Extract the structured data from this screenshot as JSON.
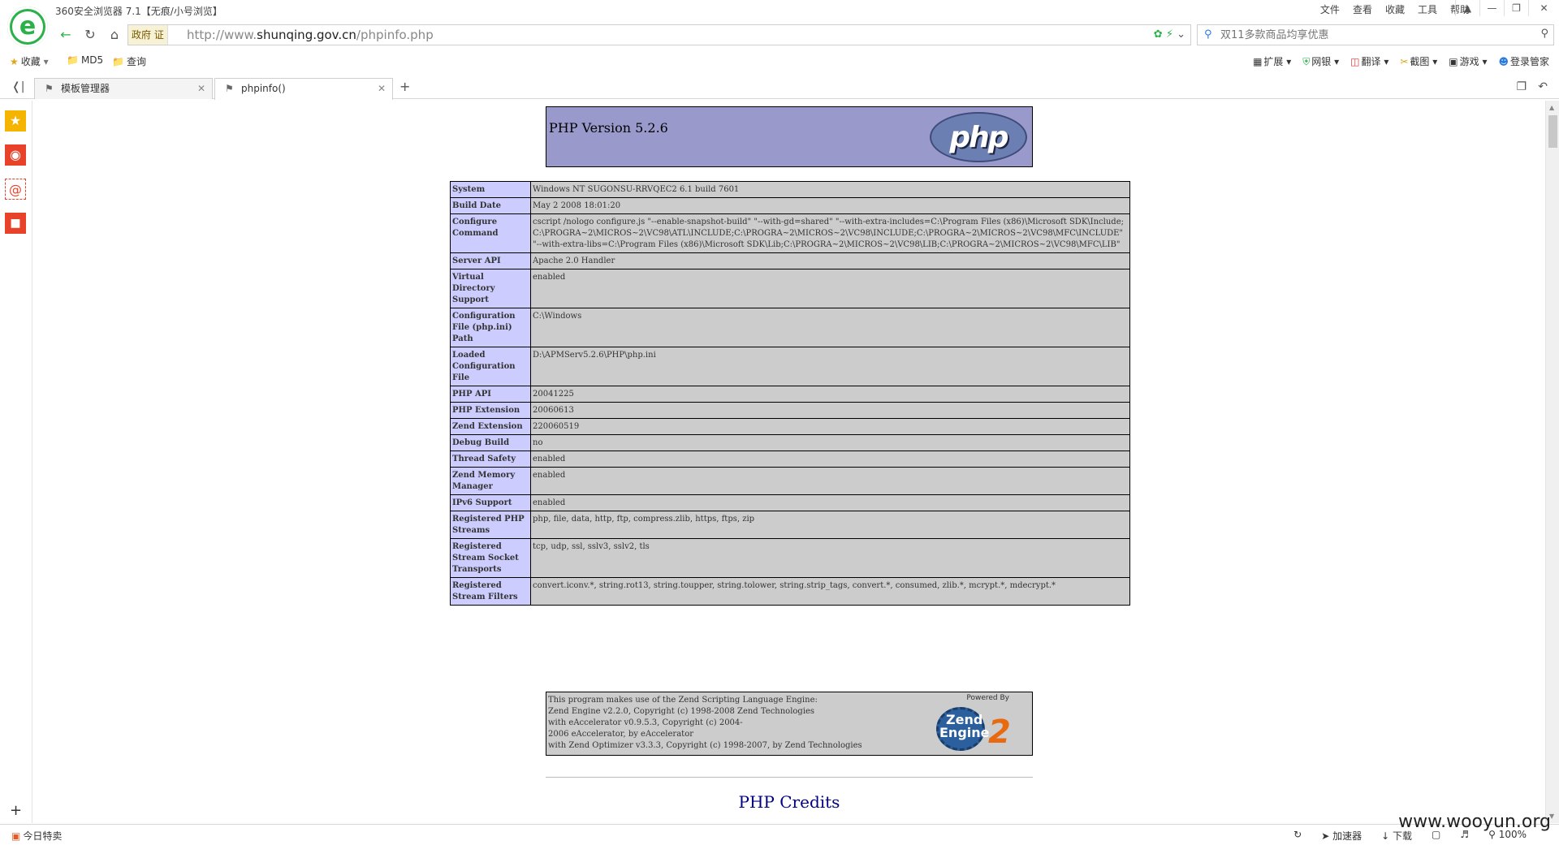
{
  "browser": {
    "title": "360安全浏览器 7.1【无痕/小号浏览】",
    "logo_letter": "e",
    "menu": [
      "文件",
      "查看",
      "收藏",
      "工具",
      "帮助"
    ],
    "window_controls": [
      "shirt-icon",
      "minimize-icon",
      "restore-icon",
      "close-icon"
    ]
  },
  "address": {
    "gov_badge": "政府 证",
    "url_prefix": "http://www.",
    "url_domain": "shunqing.gov.cn",
    "url_path": "/phpinfo.php",
    "search_placeholder": "双11多款商品均享优惠"
  },
  "bookmarks": {
    "items": [
      "收藏",
      "MD5",
      "查询"
    ],
    "tools": [
      "扩展",
      "网银",
      "翻译",
      "截图",
      "游戏",
      "登录管家"
    ]
  },
  "tabs": [
    {
      "label": "模板管理器",
      "active": false
    },
    {
      "label": "phpinfo()",
      "active": true
    }
  ],
  "php": {
    "version_title": "PHP Version 5.2.6",
    "logo_text": "php",
    "rows": [
      {
        "key": "System",
        "value": "Windows NT SUGONSU-RRVQEC2 6.1 build 7601"
      },
      {
        "key": "Build Date",
        "value": "May 2 2008 18:01:20"
      },
      {
        "key": "Configure Command",
        "value": "cscript /nologo configure.js \"--enable-snapshot-build\" \"--with-gd=shared\" \"--with-extra-includes=C:\\Program Files (x86)\\Microsoft SDK\\Include;C:\\PROGRA~2\\MICROS~2\\VC98\\ATL\\INCLUDE;C:\\PROGRA~2\\MICROS~2\\VC98\\INCLUDE;C:\\PROGRA~2\\MICROS~2\\VC98\\MFC\\INCLUDE\" \"--with-extra-libs=C:\\Program Files (x86)\\Microsoft SDK\\Lib;C:\\PROGRA~2\\MICROS~2\\VC98\\LIB;C:\\PROGRA~2\\MICROS~2\\VC98\\MFC\\LIB\""
      },
      {
        "key": "Server API",
        "value": "Apache 2.0 Handler"
      },
      {
        "key": "Virtual Directory Support",
        "value": "enabled"
      },
      {
        "key": "Configuration File (php.ini) Path",
        "value": "C:\\Windows"
      },
      {
        "key": "Loaded Configuration File",
        "value": "D:\\APMServ5.2.6\\PHP\\php.ini"
      },
      {
        "key": "PHP API",
        "value": "20041225"
      },
      {
        "key": "PHP Extension",
        "value": "20060613"
      },
      {
        "key": "Zend Extension",
        "value": "220060519"
      },
      {
        "key": "Debug Build",
        "value": "no"
      },
      {
        "key": "Thread Safety",
        "value": "enabled"
      },
      {
        "key": "Zend Memory Manager",
        "value": "enabled"
      },
      {
        "key": "IPv6 Support",
        "value": "enabled"
      },
      {
        "key": "Registered PHP Streams",
        "value": "php, file, data, http, ftp, compress.zlib, https, ftps, zip"
      },
      {
        "key": "Registered Stream Socket Transports",
        "value": "tcp, udp, ssl, sslv3, sslv2, tls"
      },
      {
        "key": "Registered Stream Filters",
        "value": "convert.iconv.*, string.rot13, string.toupper, string.tolower, string.strip_tags, convert.*, consumed, zlib.*, mcrypt.*, mdecrypt.*"
      }
    ],
    "zend_text": "This program makes use of the Zend Scripting Language Engine:\nZend Engine v2.2.0, Copyright (c) 1998-2008 Zend Technologies\n    with eAccelerator v0.9.5.3, Copyright (c) 2004-\n2006 eAccelerator, by eAccelerator\n    with Zend Optimizer v3.3.3, Copyright (c) 1998-2007, by Zend Technologies",
    "zend_powered": "Powered By",
    "zend_logo_1": "Zend",
    "zend_logo_2": "Engine",
    "zend_logo_3": "2",
    "credits": "PHP Credits"
  },
  "status": {
    "left": "今日特卖",
    "right": [
      "加速器",
      "下载",
      "100%"
    ],
    "watermark": "www.wooyun.org"
  }
}
